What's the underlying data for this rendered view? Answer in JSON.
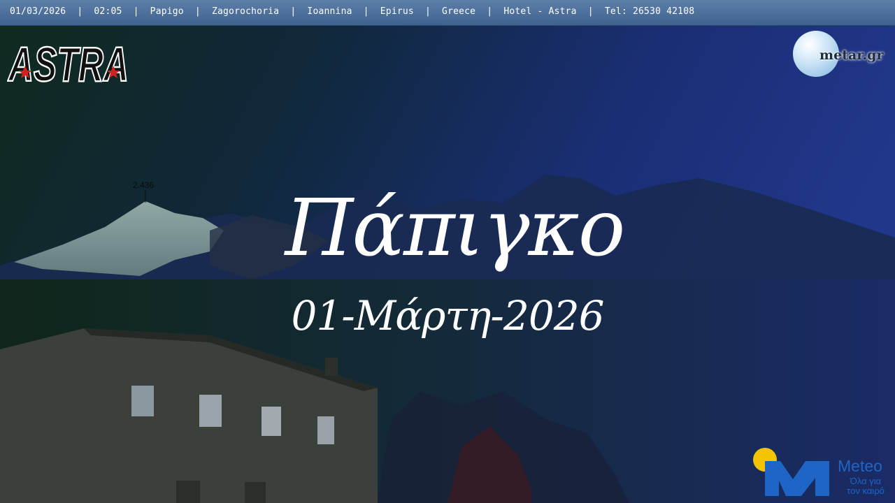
{
  "status_bar": {
    "text": "01/03/2026  |  02:05  |  Papigo  |  Zagorochoria  |  Ioannina  |  Epirus  |  Greece  |  Hotel - Astra  |  Tel: 26530 42108"
  },
  "logos": {
    "astra": "ASTRA",
    "metar": "metar.gr",
    "meteo_title": "Meteo",
    "meteo_tagline_1": "Όλα για",
    "meteo_tagline_2": "τον καιρό"
  },
  "overlay": {
    "title": "Πάπιγκο",
    "date": "01-Μάρτη-2026"
  },
  "peak_label": "2.436",
  "colors": {
    "sky": "#1f3580",
    "mountain_light": "#8fa8a0",
    "building": "#3a3f3a",
    "meteo_blue": "#1f65c6",
    "meteo_sun": "#f5c400"
  }
}
